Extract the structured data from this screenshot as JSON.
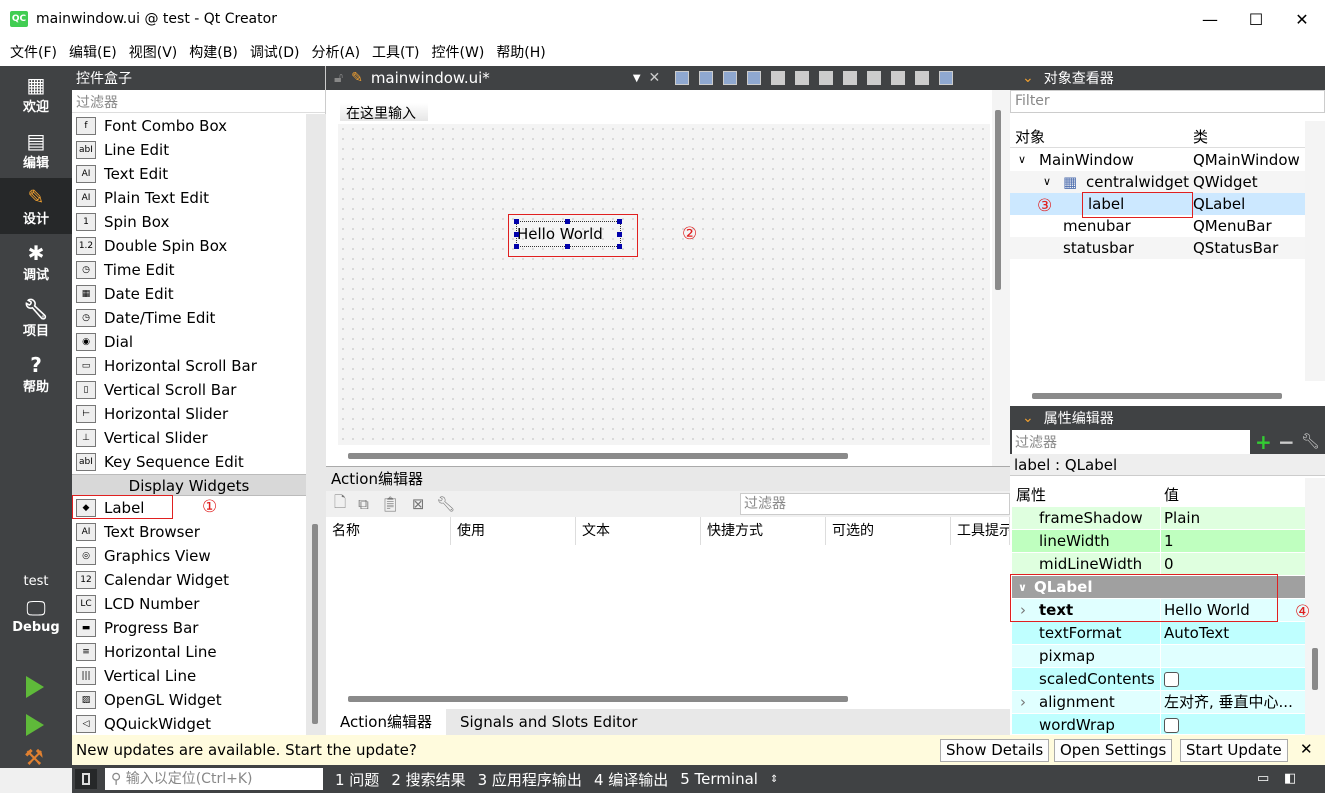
{
  "window": {
    "title": "mainwindow.ui @ test - Qt Creator",
    "logo": "QC",
    "min": "—",
    "max": "☐",
    "close": "✕"
  },
  "menu": [
    "文件(F)",
    "编辑(E)",
    "视图(V)",
    "构建(B)",
    "调试(D)",
    "分析(A)",
    "工具(T)",
    "控件(W)",
    "帮助(H)"
  ],
  "modes": [
    {
      "label": "欢迎",
      "icon": "grid-icon"
    },
    {
      "label": "编辑",
      "icon": "document-icon"
    },
    {
      "label": "设计",
      "icon": "pencil-icon"
    },
    {
      "label": "调试",
      "icon": "bug-icon"
    },
    {
      "label": "项目",
      "icon": "wrench-icon"
    },
    {
      "label": "帮助",
      "icon": "help-icon"
    }
  ],
  "kit": {
    "project": "test",
    "config": "Debug"
  },
  "widgetbox": {
    "title": "控件盒子",
    "filter_placeholder": "过滤器",
    "items_before": [
      "Font Combo Box",
      "Line Edit",
      "Text Edit",
      "Plain Text Edit",
      "Spin Box",
      "Double Spin Box",
      "Time Edit",
      "Date Edit",
      "Date/Time Edit",
      "Dial",
      "Horizontal Scroll Bar",
      "Vertical Scroll Bar",
      "Horizontal Slider",
      "Vertical Slider",
      "Key Sequence Edit"
    ],
    "category": "Display Widgets",
    "items_after": [
      "Label",
      "Text Browser",
      "Graphics View",
      "Calendar Widget",
      "LCD Number",
      "Progress Bar",
      "Horizontal Line",
      "Vertical Line",
      "OpenGL Widget",
      "QQuickWidget"
    ]
  },
  "editor": {
    "file": "mainwindow.ui*",
    "menu_placeholder": "在这里输入",
    "label_text": "Hello World"
  },
  "annotations": [
    "①",
    "②",
    "③",
    "④"
  ],
  "action_editor": {
    "title": "Action编辑器",
    "filter_placeholder": "过滤器",
    "columns": [
      "名称",
      "使用",
      "文本",
      "快捷方式",
      "可选的",
      "工具提示"
    ],
    "tabs": [
      "Action编辑器",
      "Signals and Slots Editor"
    ]
  },
  "object_inspector": {
    "title": "对象查看器",
    "filter_placeholder": "Filter",
    "columns": [
      "对象",
      "类"
    ],
    "rows": [
      {
        "name": "MainWindow",
        "class": "QMainWindow"
      },
      {
        "name": "centralwidget",
        "class": "QWidget"
      },
      {
        "name": "label",
        "class": "QLabel"
      },
      {
        "name": "menubar",
        "class": "QMenuBar"
      },
      {
        "name": "statusbar",
        "class": "QStatusBar"
      }
    ]
  },
  "property_editor": {
    "title": "属性编辑器",
    "filter_placeholder": "过滤器",
    "object": "label : QLabel",
    "columns": [
      "属性",
      "值"
    ],
    "rows": [
      {
        "name": "frameShadow",
        "value": "Plain"
      },
      {
        "name": "lineWidth",
        "value": "1"
      },
      {
        "name": "midLineWidth",
        "value": "0"
      }
    ],
    "group": "QLabel",
    "label_rows": [
      {
        "name": "text",
        "value": "Hello World"
      },
      {
        "name": "textFormat",
        "value": "AutoText"
      },
      {
        "name": "pixmap",
        "value": ""
      },
      {
        "name": "scaledContents",
        "value": ""
      },
      {
        "name": "alignment",
        "value": "左对齐, 垂直中心..."
      },
      {
        "name": "wordWrap",
        "value": ""
      }
    ]
  },
  "notification": {
    "message": "New updates are available. Start the update?",
    "buttons": [
      "Show Details",
      "Open Settings",
      "Start Update"
    ],
    "close": "✕"
  },
  "statusbar": {
    "locator_placeholder": "输入以定位(Ctrl+K)",
    "outputs": [
      "1 问题",
      "2 搜索结果",
      "3 应用程序输出",
      "4 编译输出",
      "5 Terminal"
    ]
  }
}
